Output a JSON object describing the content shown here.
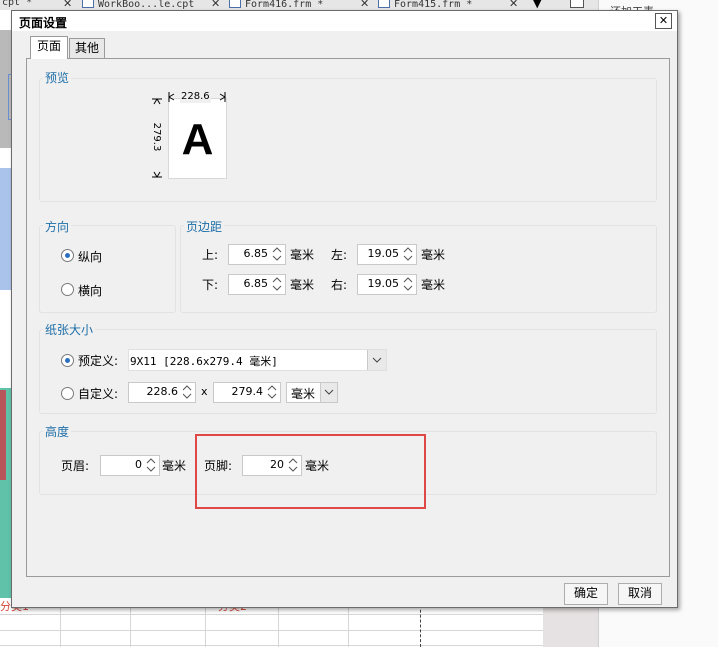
{
  "background": {
    "tabs": [
      {
        "label": "cpt *"
      },
      {
        "label": "WorkBoo...le.cpt"
      },
      {
        "label": "Form416.frm *"
      },
      {
        "label": "Form415.frm *"
      }
    ],
    "right_text": "还加工表",
    "red_labels": [
      "分类1",
      "分类2"
    ]
  },
  "dialog": {
    "title": "页面设置",
    "close_glyph": "✕",
    "tabs": [
      "页面",
      "其他"
    ],
    "preview": {
      "group_title": "预览",
      "width_label": "228.6",
      "height_label": "279.3",
      "letter": "A"
    },
    "orientation": {
      "group_title": "方向",
      "portrait": "纵向",
      "landscape": "横向",
      "selected": "portrait"
    },
    "margins": {
      "group_title": "页边距",
      "top_label": "上:",
      "top_value": "6.85",
      "bottom_label": "下:",
      "bottom_value": "6.85",
      "left_label": "左:",
      "left_value": "19.05",
      "right_label": "右:",
      "right_value": "19.05",
      "unit": "毫米"
    },
    "paper": {
      "group_title": "纸张大小",
      "predefined_label": "预定义:",
      "predefined_value": "9X11 [228.6x279.4 毫米]",
      "custom_label": "自定义:",
      "custom_width": "228.6",
      "custom_x": "x",
      "custom_height": "279.4",
      "custom_unit": "毫米",
      "selected": "predefined"
    },
    "height": {
      "group_title": "高度",
      "header_label": "页眉:",
      "header_value": "0",
      "footer_label": "页脚:",
      "footer_value": "20",
      "unit": "毫米"
    },
    "buttons": {
      "ok": "确定",
      "cancel": "取消"
    }
  },
  "colors": {
    "group_title": "#1e6ea8",
    "highlight": "#e04848",
    "radio_dot": "#2c6fbf"
  }
}
